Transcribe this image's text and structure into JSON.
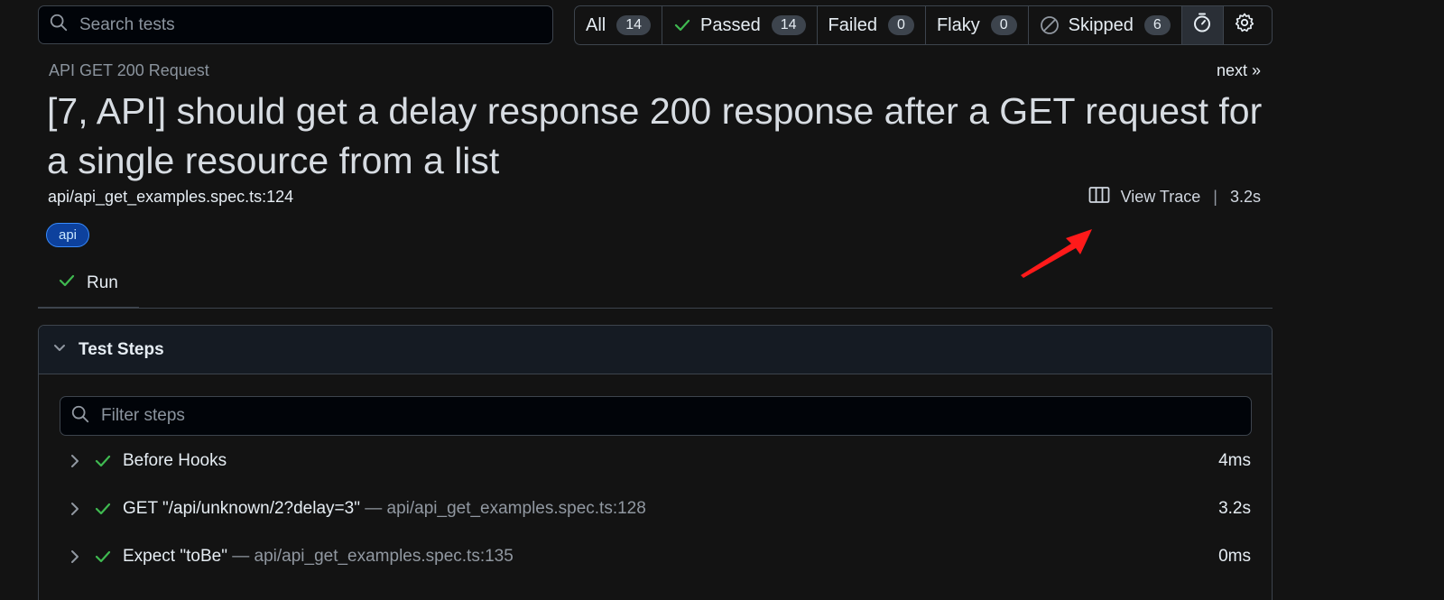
{
  "search": {
    "placeholder": "Search tests",
    "icon": "search-icon"
  },
  "filters": {
    "all": {
      "label": "All",
      "count": "14"
    },
    "passed": {
      "label": "Passed",
      "count": "14",
      "icon": "check-icon"
    },
    "failed": {
      "label": "Failed",
      "count": "0"
    },
    "flaky": {
      "label": "Flaky",
      "count": "0"
    },
    "skipped": {
      "label": "Skipped",
      "count": "6",
      "icon": "skip-icon"
    },
    "icons": [
      "stopwatch-icon",
      "gear-icon"
    ]
  },
  "header": {
    "suite": "API GET 200 Request",
    "next": "next »",
    "title": "[7, API] should get a delay response 200 response after a GET request for a single resource from a list",
    "location": "api/api_get_examples.spec.ts:124",
    "trace_label": "View Trace",
    "separator": "|",
    "duration": "3.2s",
    "tag": "api"
  },
  "tabs": [
    {
      "label": "Run",
      "status": "passed"
    }
  ],
  "steps_panel": {
    "title": "Test Steps",
    "filter_placeholder": "Filter steps",
    "steps": [
      {
        "title": "Before Hooks",
        "location": "",
        "duration": "4ms"
      },
      {
        "title": "GET \"/api/unknown/2?delay=3\"",
        "location": " — api/api_get_examples.spec.ts:128",
        "duration": "3.2s"
      },
      {
        "title": "Expect \"toBe\"",
        "location": " — api/api_get_examples.spec.ts:135",
        "duration": "0ms"
      }
    ]
  },
  "colors": {
    "background": "#131313",
    "success": "#3fb950",
    "accent_tag": "#388bfd",
    "annotation_arrow": "#ff1a1a"
  }
}
